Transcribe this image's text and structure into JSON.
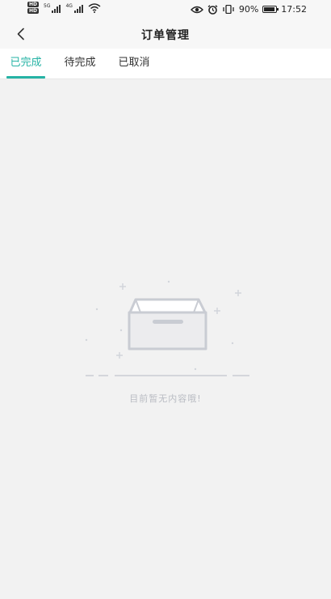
{
  "status_bar": {
    "left_badges": [
      "HD",
      "HD"
    ],
    "network_labels": [
      "5G",
      "4G"
    ],
    "battery_text": "90%",
    "time": "17:52",
    "icons": [
      "eye-icon",
      "alarm-icon",
      "vibrate-icon",
      "battery-icon"
    ]
  },
  "header": {
    "title": "订单管理",
    "back_icon": "chevron-left-icon"
  },
  "tabs": [
    {
      "label": "已完成",
      "active": true
    },
    {
      "label": "待完成",
      "active": false
    },
    {
      "label": "已取消",
      "active": false
    }
  ],
  "empty_state": {
    "icon": "empty-box-icon",
    "message": "目前暂无内容哦!"
  },
  "colors": {
    "accent": "#26b3a5",
    "background": "#f2f2f2",
    "empty_text": "#b9bcc3",
    "illustration": "#c9ccd3"
  }
}
